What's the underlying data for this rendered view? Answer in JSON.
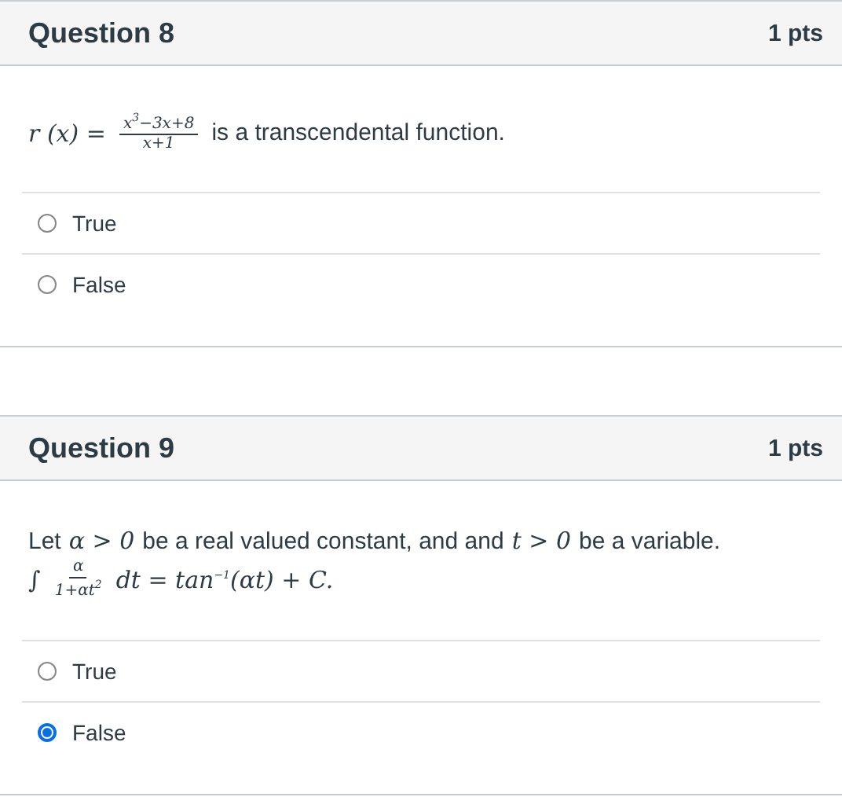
{
  "questions": [
    {
      "title": "Question 8",
      "points": "1 pts",
      "stem_lines": [
        [
          {
            "kind": "math",
            "text": "r (x) ="
          },
          {
            "kind": "frac",
            "num": "x$^{3}$−3x+8",
            "den": "x+1"
          },
          {
            "kind": "text",
            "text": "is a transcendental function."
          }
        ]
      ],
      "answers": [
        {
          "label": "True",
          "selected": false
        },
        {
          "label": "False",
          "selected": false
        }
      ]
    },
    {
      "title": "Question 9",
      "points": "1 pts",
      "stem_lines": [
        [
          {
            "kind": "text",
            "text": "Let"
          },
          {
            "kind": "math",
            "text": "α > 0"
          },
          {
            "kind": "text",
            "text": "be a real valued constant, and and"
          },
          {
            "kind": "math",
            "text": "t > 0"
          },
          {
            "kind": "text",
            "text": "be a variable."
          }
        ],
        [
          {
            "kind": "math",
            "text": "∫"
          },
          {
            "kind": "frac",
            "num": "α",
            "den": "1+αt$^{2}$"
          },
          {
            "kind": "math",
            "text": "dt = tan$^{−1}$(αt) + C."
          }
        ]
      ],
      "answers": [
        {
          "label": "True",
          "selected": false
        },
        {
          "label": "False",
          "selected": true
        }
      ]
    }
  ]
}
